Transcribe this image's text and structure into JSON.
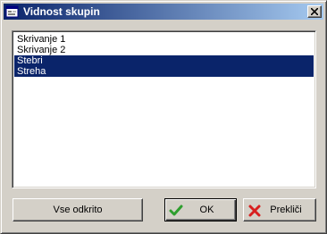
{
  "window": {
    "title": "Vidnost skupin",
    "icon": "app-window-icon",
    "close_icon": "close-icon"
  },
  "groups": [
    {
      "label": "Skrivanje 1",
      "selected": false
    },
    {
      "label": "Skrivanje 2",
      "selected": false
    },
    {
      "label": "Stebri",
      "selected": true
    },
    {
      "label": "Streha",
      "selected": true
    }
  ],
  "buttons": {
    "show_all_label": "Vse odkrito",
    "ok_label": "OK",
    "ok_icon": "checkmark-icon",
    "cancel_label": "Prekliči",
    "cancel_icon": "cross-icon"
  },
  "colors": {
    "title_gradient_start": "#0a246a",
    "title_gradient_end": "#a6caf0",
    "selection": "#0a246a",
    "ok_icon": "#2e9e2e",
    "cancel_icon": "#d81f1f"
  }
}
